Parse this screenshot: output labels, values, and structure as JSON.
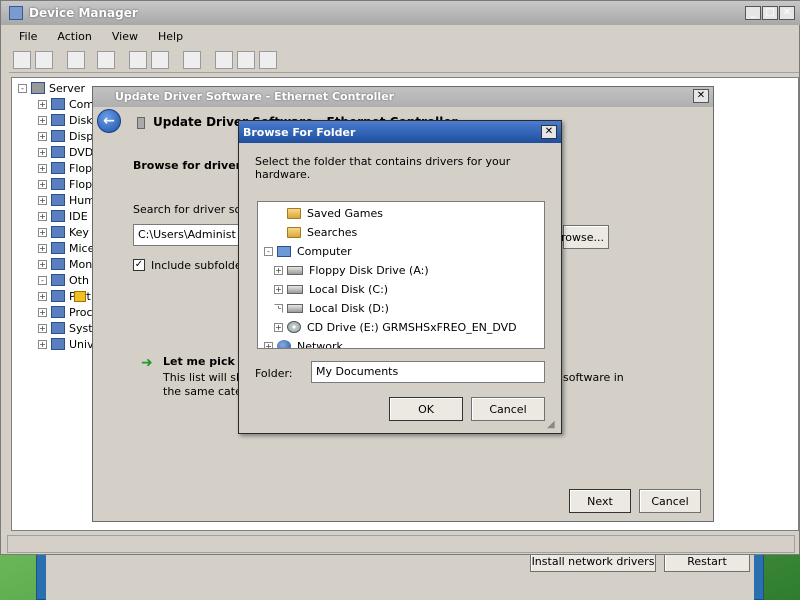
{
  "installer": {
    "install_label": "Install network drivers",
    "restart_label": "Restart"
  },
  "device_manager": {
    "title": "Device Manager",
    "menu": [
      "File",
      "Action",
      "View",
      "Help"
    ],
    "tree": {
      "root": "Server",
      "items": [
        "Com",
        "Disk",
        "Disp",
        "DVD",
        "Flop",
        "Flop",
        "Hum",
        "IDE",
        "Key",
        "Mice",
        "Mon",
        "Oth",
        "Port",
        "Proc",
        "Syst",
        "Univ"
      ]
    }
  },
  "update_dialog": {
    "title": "Update Driver Software - Ethernet Controller",
    "heading": "Update Driver Software - Ethernet Controller",
    "subheading": "Browse for driver s",
    "search_label": "Search for driver sof",
    "path_value": "C:\\Users\\Administ",
    "browse_label": "Browse...",
    "include_subfolders_label": "Include subfolde",
    "include_subfolders_checked": true,
    "pick_title": "Let me pick fr",
    "pick_desc_line1": "This list will show",
    "pick_desc_line2": "the same categ",
    "side_text_line1": "software in",
    "side_text_line2": "",
    "next_label": "Next",
    "cancel_label": "Cancel"
  },
  "browse_dialog": {
    "title": "Browse For Folder",
    "description": "Select the folder that contains drivers for your hardware.",
    "tree": [
      {
        "label": "Saved Games",
        "icon": "folder-icon",
        "indent": 2,
        "expander": false
      },
      {
        "label": "Searches",
        "icon": "folder-icon",
        "indent": 2,
        "expander": false
      },
      {
        "label": "Computer",
        "icon": "computer-icon",
        "indent": 1,
        "expander": "-"
      },
      {
        "label": "Floppy Disk Drive (A:)",
        "icon": "floppy-icon",
        "indent": 2,
        "expander": "+"
      },
      {
        "label": "Local Disk (C:)",
        "icon": "drive-icon",
        "indent": 2,
        "expander": "+"
      },
      {
        "label": "Local Disk (D:)",
        "icon": "drive-icon",
        "indent": 2,
        "expander": "+"
      },
      {
        "label": "CD Drive (E:) GRMSHSxFREO_EN_DVD",
        "icon": "cd-icon",
        "indent": 2,
        "expander": "+"
      },
      {
        "label": "Network",
        "icon": "network-icon",
        "indent": 1,
        "expander": "+"
      }
    ],
    "folder_label": "Folder:",
    "folder_value": "My Documents",
    "ok_label": "OK",
    "cancel_label": "Cancel"
  }
}
